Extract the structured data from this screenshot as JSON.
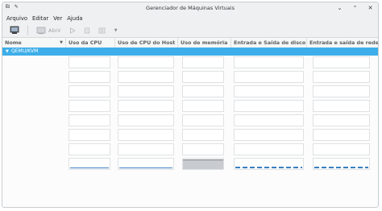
{
  "window": {
    "title": "Gerenciador de Máquinas Virtuais"
  },
  "menu": [
    "Arquivo",
    "Editar",
    "Ver",
    "Ajuda"
  ],
  "toolbar": {
    "open_label": "Abrir"
  },
  "columns": [
    "Nome",
    "Uso da CPU",
    "Uso de CPU do Host",
    "Uso de memória",
    "Entrada e Saída de disco",
    "Entrada e saída de rede"
  ],
  "connection": {
    "name": "QEMU/KVM"
  },
  "icons": {
    "app": "app-icon",
    "pin": "pin-icon",
    "minimize": "chevron-down-icon",
    "maximize": "chevron-up-icon",
    "close": "close-icon",
    "new_vm": "monitor-icon",
    "open": "console-icon",
    "run": "play-icon",
    "pause": "pause-icon",
    "shutdown": "shutdown-icon"
  },
  "colors": {
    "selection": "#3daee9",
    "graph": "#3a7fc0"
  }
}
